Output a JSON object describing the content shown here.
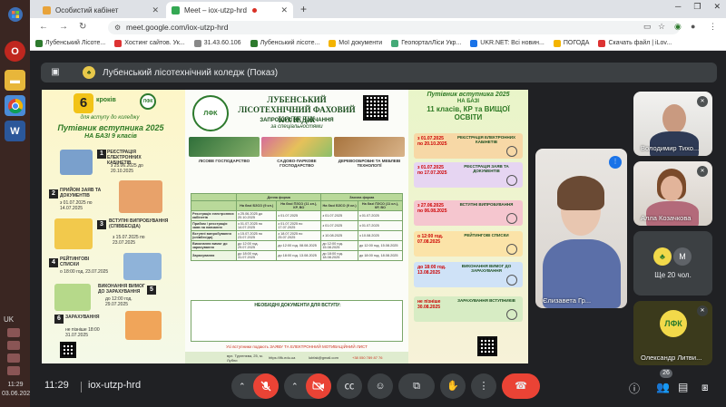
{
  "browser": {
    "tabs": [
      {
        "title": "Особистий кабінет",
        "active": false,
        "favicon_color": "#e8a33a"
      },
      {
        "title": "Meet – iox-utzp-hrd",
        "active": true,
        "favicon_color": "#34a853"
      }
    ],
    "url": "meet.google.com/iox-utzp-hrd",
    "bookmarks": [
      {
        "label": "Лубенський Лісоте...",
        "color": "#2d7a2d"
      },
      {
        "label": "Хостинг сайтов. Ук...",
        "color": "#d33"
      },
      {
        "label": "31.43.60.106",
        "color": "#888"
      },
      {
        "label": "Лубенський лісоте...",
        "color": "#2d7a2d"
      },
      {
        "label": "Мої документи",
        "color": "#f4b400"
      },
      {
        "label": "ГеопорталЛіси Укр...",
        "color": "#4a7"
      },
      {
        "label": "UKR.NET: Всі новин...",
        "color": "#1a73e8"
      },
      {
        "label": "ПОГОДА",
        "color": "#f4b400"
      },
      {
        "label": "Скачать файл | iLov...",
        "color": "#d33"
      }
    ]
  },
  "taskbar": {
    "lang": "UK",
    "time": "11:29",
    "date": "03.06.2025"
  },
  "presentation": {
    "title": "Лубенський лісотехнічний коледж (Показ)"
  },
  "slide": {
    "left": {
      "badge": "6",
      "badge_text": "кроків",
      "subtitle": "для вступу до коледжу",
      "heading1": "Путівник вступника 2025",
      "heading2": "НА БАЗІ 9 класів",
      "steps": [
        {
          "num": "1",
          "title": "РЕЄСТРАЦІЯ ЕЛЕКТРОННИХ КАБІНЕТІВ",
          "dates": "з 25.06.2025 до 20.10.2025"
        },
        {
          "num": "2",
          "title": "ПРИЙОМ ЗАЯВ ТА ДОКУМЕНТІВ",
          "dates": "з 01.07.2025 по 14.07.2025"
        },
        {
          "num": "3",
          "title": "ВСТУПНІ ВИПРОБУВАННЯ (СПІВБЕСІДА)",
          "dates": "з 15.07.2025 по 23.07.2025"
        },
        {
          "num": "4",
          "title": "РЕЙТИНГОВІ СПИСКИ",
          "dates": "о 18:00 год. 23.07.2025"
        },
        {
          "num": "5",
          "title": "ВИКОНАННЯ ВИМОГ ДО ЗАРАХУВАННЯ",
          "dates": "до 12:00 год. 29.07.2025"
        },
        {
          "num": "6",
          "title": "ЗАРАХУВАННЯ",
          "dates": "не пізніше 18:00 31.07.2025"
        }
      ]
    },
    "middle": {
      "title": "ЛУБЕНСЬКИЙ ЛІСОТЕХНІЧНИЙ ФАХОВИЙ КОЛЕДЖ",
      "invite": "ЗАПРОШУЄ НА НАВЧАННЯ",
      "invite2": "за спеціальностями",
      "logo_text": "ЛФК",
      "specialties": [
        "ЛІСОВЕ ГОСПОДАРСТВО",
        "САДОВО-ПАРКОВЕ ГОСПОДАРСТВО",
        "ДЕРЕВООБРОБНІ ТА МЕБЛЕВІ ТЕХНОЛОГІЇ"
      ],
      "table_headers": [
        "",
        "На базі БЗСО (9 кл.)",
        "На базі ПЗСО (11 кл.), КР, ВО",
        "На базі БЗСО (9 кл.)",
        "На базі ПЗСО (11 кл.), КР, ВО"
      ],
      "table_groups": [
        "Денна форма",
        "Заочна форма"
      ],
      "table_rows": [
        {
          "label": "Реєстрація електронних кабінетів",
          "cells": [
            "з 25.06.2025 до 20.10.2025",
            "з 01.07.2025",
            "з 01.07.2025",
            "з 01.07.2025"
          ]
        },
        {
          "label": "Прийом / реєстрація заяв на навчання",
          "cells": [
            "з 01.07.2025 по 14.07.2025",
            "з 01.07.2025 по 17.07.2025",
            "з 01.07.2025",
            "з 01.07.2025"
          ]
        },
        {
          "label": "Вступні випробування (співбесіда)",
          "cells": [
            "з 15.07.2025 по 23.07.2025",
            "з 18.07.2025 по 25.07.2025",
            "з 10.08.2025",
            "з 10.08.2025"
          ]
        },
        {
          "label": "Виконання вимог до зарахування",
          "cells": [
            "до 12:00 год. 29.07.2025",
            "до 12:00 год. 08.08.2025",
            "до 12:00 год. 15.08.2025",
            "до 12:00 год. 15.08.2025"
          ]
        },
        {
          "label": "Зарахування",
          "cells": [
            "до 18:00 год. 31.07.2025",
            "до 18:00 год. 13.08.2025",
            "до 18:00 год. 18.08.2025",
            "до 18:00 год. 18.08.2025"
          ]
        }
      ],
      "docs_title": "НЕОБХІДНІ ДОКУМЕНТИ ДЛЯ ВСТУПУ:",
      "footer_note": "Усі вступники подають ЗАЯВУ ТА ЕЛЕКТРОННИЙ МОТИВАЦІЙНИЙ ЛИСТ",
      "contacts": [
        "вул. Тургенєва, 25, м. Лубни",
        "https://lfk.edu.ua",
        "lubfak@gmail.com",
        "+38 050 789 87 76"
      ]
    },
    "right": {
      "heading1": "Путівник вступника 2025",
      "heading2": "НА БАЗІ",
      "heading3": "11 класів, КР та ВИЩОЇ ОСВІТИ",
      "boxes": [
        {
          "dates": "з 01.07.2025 по 20.10.2025",
          "title": "РЕЄСТРАЦІЯ ЕЛЕКТРОННИХ КАБІНЕТІВ",
          "color": "#f7d8a6"
        },
        {
          "dates": "з 01.07.2025 по 17.07.2025",
          "title": "РЕЄСТРАЦІЯ ЗАЯВ ТА ДОКУМЕНТІВ",
          "color": "#e6d5f2"
        },
        {
          "dates": "з 27.06.2025 по 06.08.2025",
          "title": "ВСТУПНІ ВИПРОБУВАННЯ",
          "color": "#f5c6cf"
        },
        {
          "dates": "о 12:00 год. 07.08.2025",
          "title": "РЕЙТИНГОВІ СПИСКИ",
          "color": "#fbe3a8"
        },
        {
          "dates": "до 18:00 год. 13.08.2025",
          "title": "ВИКОНАННЯ ВИМОГ ДО ЗАРАХУВАННЯ",
          "color": "#cfe2f7"
        },
        {
          "dates": "не пізніше 30.08.2025",
          "title": "ЗАРАХУВАННЯ ВСТУПНИКІВ",
          "color": "#d7ecc4"
        }
      ]
    }
  },
  "participants": [
    {
      "name": "Володимир Тихо...",
      "muted": true
    },
    {
      "name": "Алла Козачкова",
      "muted": true
    },
    {
      "name": "Єлизавета Гр...",
      "speaking": true
    },
    {
      "name": "Олександр Литви...",
      "muted": true
    }
  ],
  "more_participants": {
    "label": "Ще 20 чол.",
    "avatar_letter": "M"
  },
  "controls": {
    "time": "11:29",
    "meeting_code": "iox-utzp-hrd",
    "participant_count": "26"
  }
}
